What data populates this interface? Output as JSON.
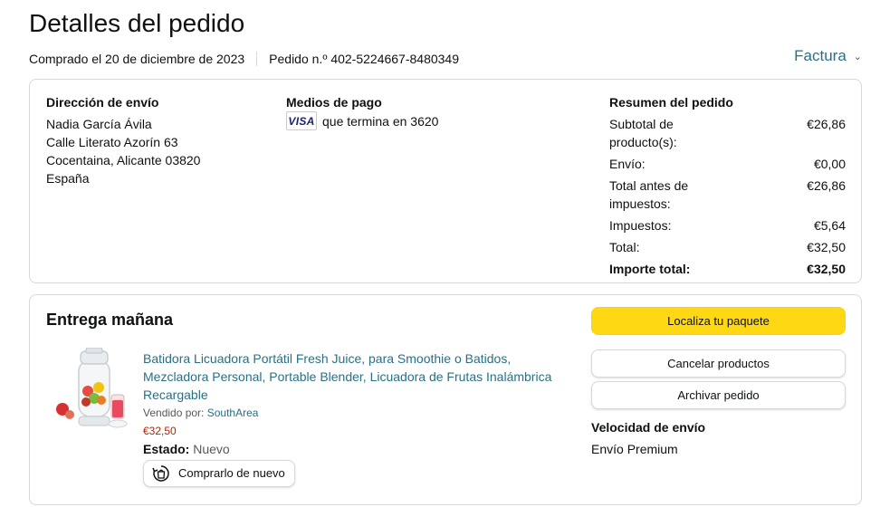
{
  "page": {
    "title": "Detalles del pedido",
    "purchase_date": "Comprado el 20 de diciembre de 2023",
    "order_number": "Pedido n.º 402-5224667-8480349",
    "invoice_label": "Factura"
  },
  "shipping": {
    "title": "Dirección de envío",
    "name": "Nadia García Ávila",
    "street": "Calle Literato Azorín 63",
    "city": "Cocentaina, Alicante 03820",
    "country": "España"
  },
  "payment": {
    "title": "Medios de pago",
    "card_brand": "VISA",
    "card_text": "que termina en 3620"
  },
  "summary": {
    "title": "Resumen del pedido",
    "rows": [
      {
        "label": "Subtotal de producto(s):",
        "value": "€26,86"
      },
      {
        "label": "Envío:",
        "value": "€0,00"
      },
      {
        "label": "Total antes de impuestos:",
        "value": "€26,86"
      },
      {
        "label": "Impuestos:",
        "value": "€5,64"
      },
      {
        "label": "Total:",
        "value": "€32,50"
      },
      {
        "label": "Importe total:",
        "value": "€32,50"
      }
    ]
  },
  "delivery": {
    "title": "Entrega mañana",
    "product_title": "Batidora Licuadora Portátil Fresh Juice, para Smoothie o Batidos, Mezcladora Personal, Portable Blender, Licuadora de Frutas Inalámbrica Recargable",
    "sold_by_label": "Vendido por:",
    "seller": "SouthArea",
    "price": "€32,50",
    "status_label": "Estado:",
    "status_value": "Nuevo",
    "buy_again_label": "Comprarlo de nuevo",
    "track_label": "Localiza tu paquete",
    "cancel_label": "Cancelar productos",
    "archive_label": "Archivar pedido",
    "speed_title": "Velocidad de envío",
    "speed_value": "Envío Premium"
  },
  "colors": {
    "link": "#2a6f84",
    "price": "#b12704",
    "primary_button": "#ffd814",
    "border": "#d5d9d9"
  },
  "icons": {
    "invoice_chevron": "chevron-down-icon",
    "buy_again": "reorder-icon",
    "card": "visa-card-icon",
    "product": "portable-blender-image"
  }
}
